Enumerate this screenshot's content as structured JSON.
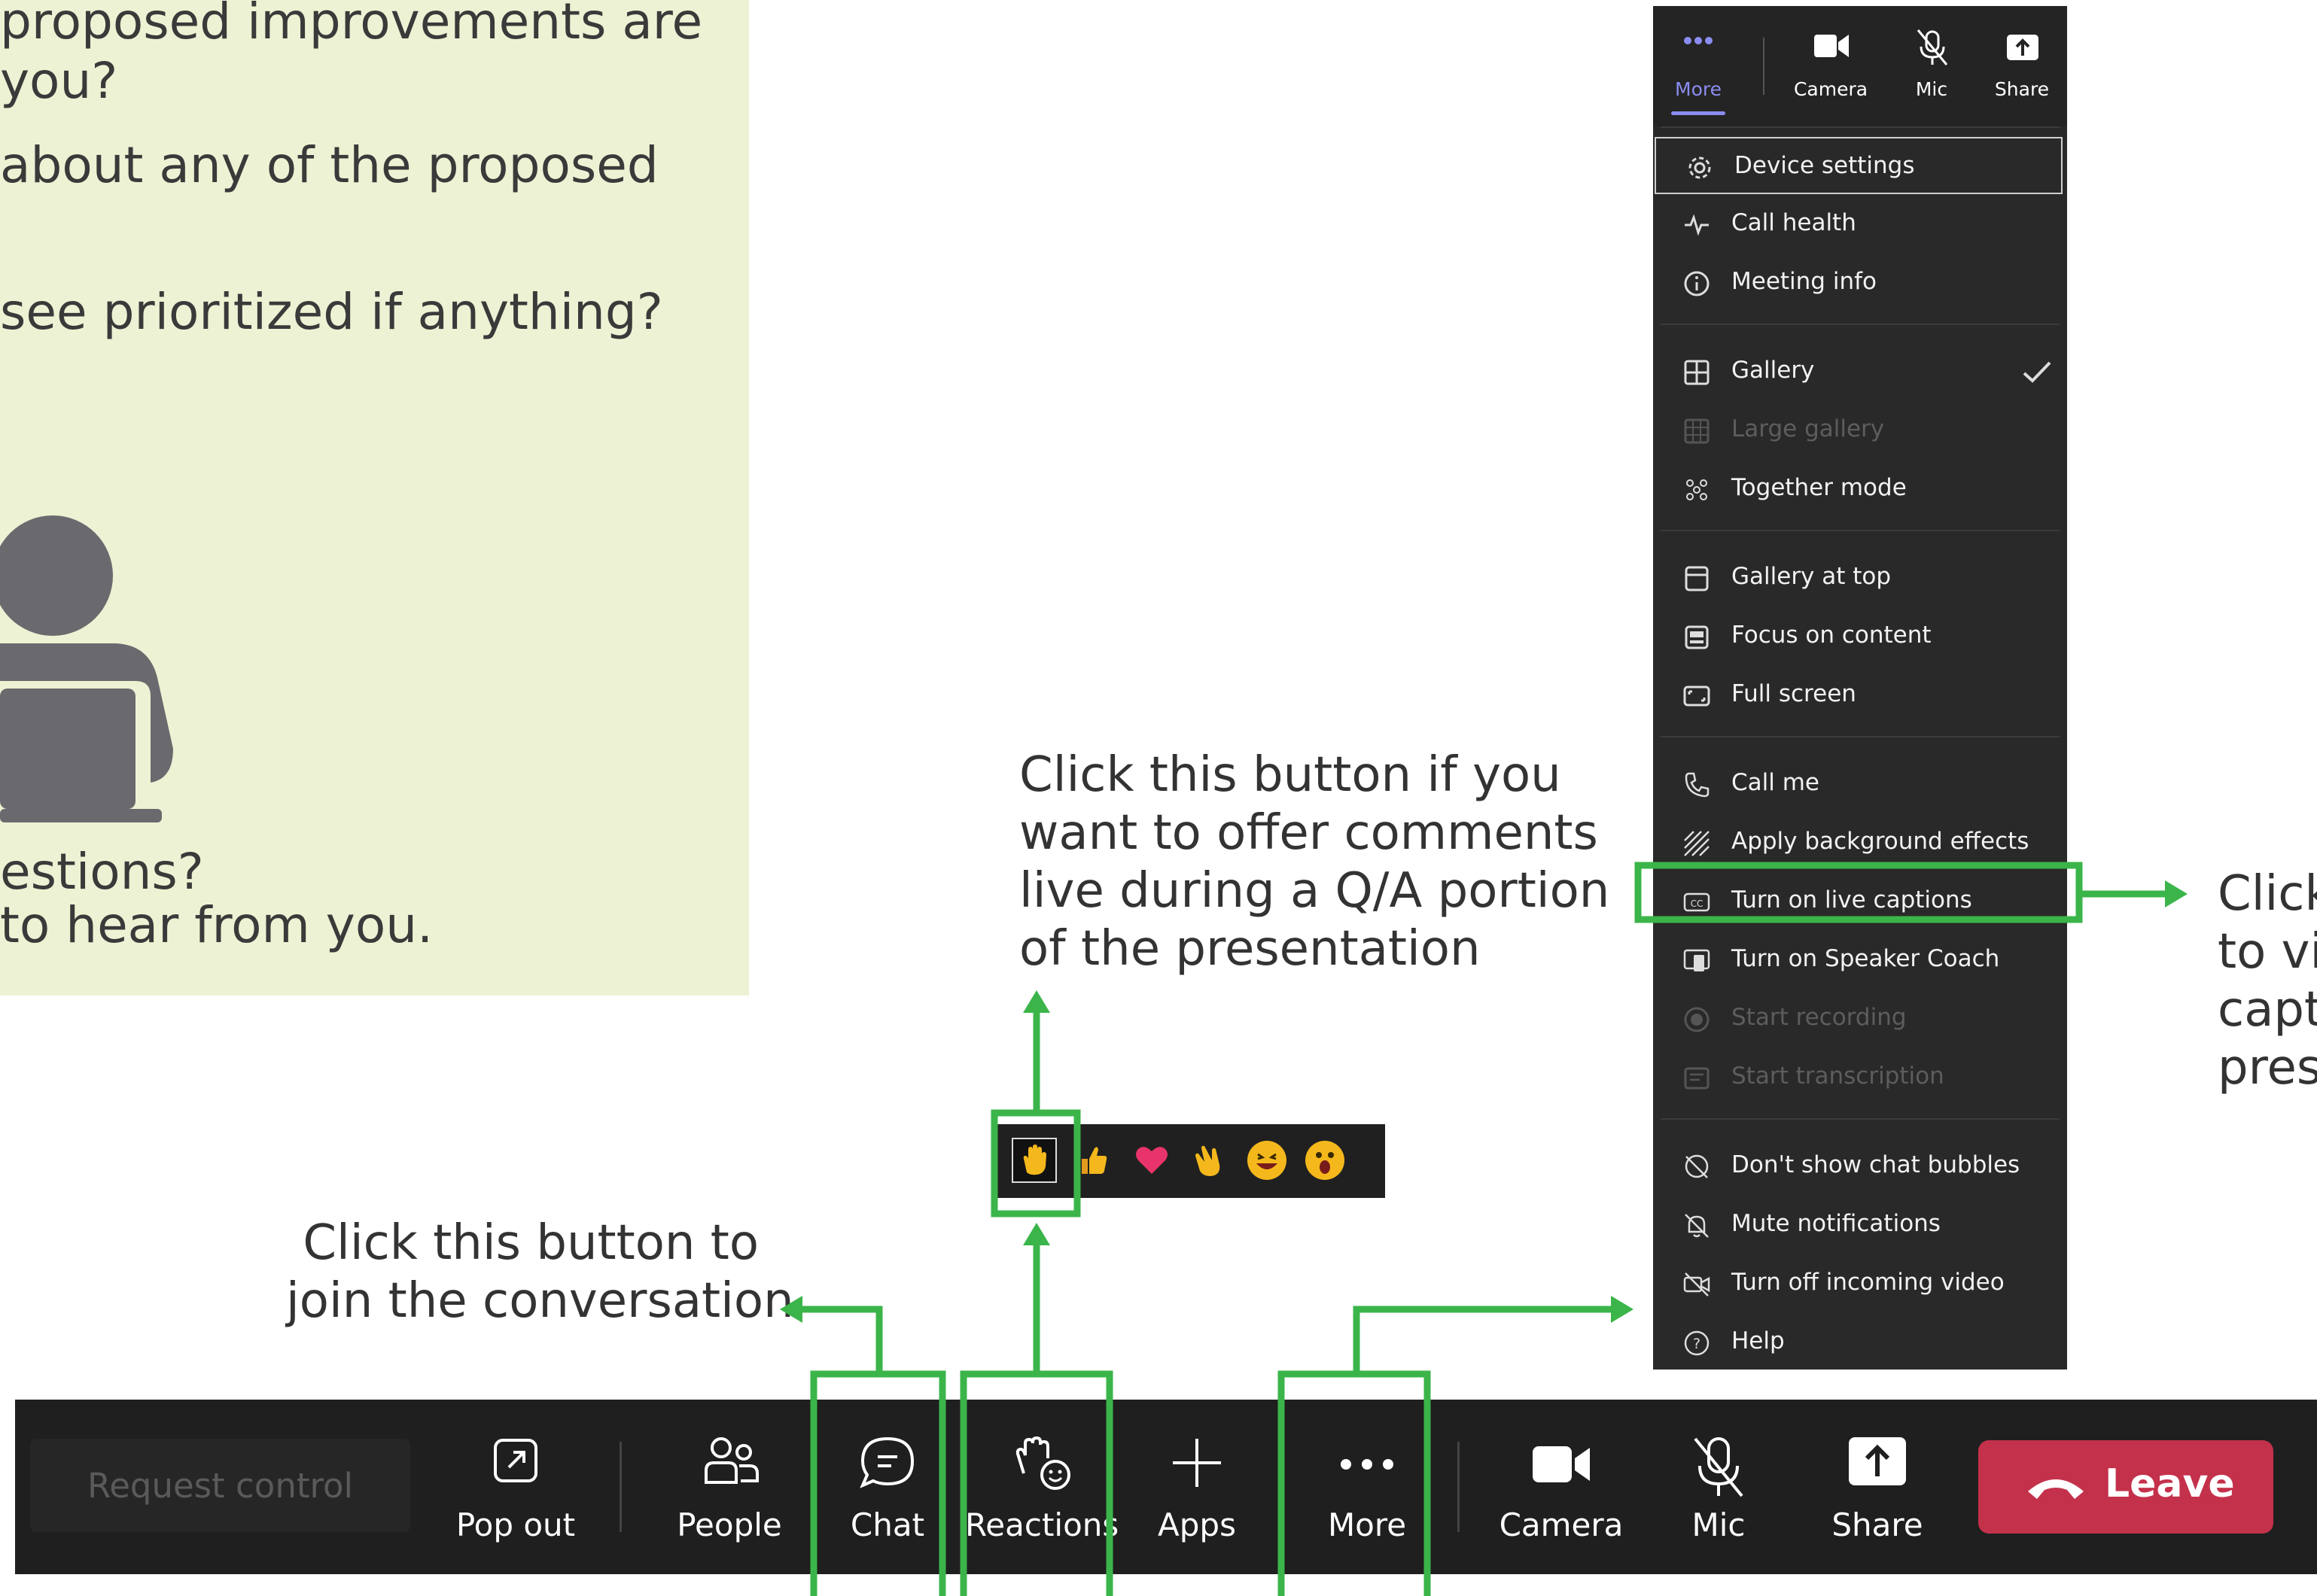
{
  "slide": {
    "line1": "proposed improvements are",
    "line2": "you?",
    "line3": "about any of the proposed",
    "line4": "see prioritized if anything?",
    "line5": "estions?",
    "line6": "to hear from you."
  },
  "callouts": {
    "reactions": [
      "Click this button if you",
      "want to offer comments",
      "live during a Q/A portion",
      "of the presentation"
    ],
    "chat": [
      "Click this button to",
      "join the conversation"
    ],
    "captions": [
      "Click",
      "to vi",
      "capt",
      "pres"
    ]
  },
  "menu": {
    "top": [
      {
        "label": "More",
        "icon": "more-icon"
      },
      {
        "label": "Camera",
        "icon": "camera-icon"
      },
      {
        "label": "Mic",
        "icon": "mic-off-icon"
      },
      {
        "label": "Share",
        "icon": "share-icon"
      }
    ],
    "items": [
      {
        "label": "Device settings",
        "icon": "gear-icon"
      },
      {
        "label": "Call health",
        "icon": "pulse-icon"
      },
      {
        "label": "Meeting info",
        "icon": "info-icon"
      },
      {
        "label": "Gallery",
        "icon": "gallery-icon",
        "checked": true
      },
      {
        "label": "Large gallery",
        "icon": "large-gallery-icon"
      },
      {
        "label": "Together mode",
        "icon": "together-mode-icon"
      },
      {
        "label": "Gallery at top",
        "icon": "gallery-top-icon"
      },
      {
        "label": "Focus on content",
        "icon": "focus-icon"
      },
      {
        "label": "Full screen",
        "icon": "fullscreen-icon"
      },
      {
        "label": "Call me",
        "icon": "phone-icon"
      },
      {
        "label": "Apply background effects",
        "icon": "background-effects-icon"
      },
      {
        "label": "Turn on live captions",
        "icon": "cc-icon"
      },
      {
        "label": "Turn on Speaker Coach",
        "icon": "speaker-coach-icon"
      },
      {
        "label": "Start recording",
        "icon": "record-icon"
      },
      {
        "label": "Start transcription",
        "icon": "transcription-icon"
      },
      {
        "label": "Don't show chat bubbles",
        "icon": "chat-bubble-off-icon"
      },
      {
        "label": "Mute notifications",
        "icon": "bell-off-icon"
      },
      {
        "label": "Turn off incoming video",
        "icon": "video-off-icon"
      },
      {
        "label": "Help",
        "icon": "help-icon"
      }
    ]
  },
  "reactions": [
    "raised-hand",
    "thumbs-up",
    "heart",
    "clap",
    "laugh",
    "surprised"
  ],
  "toolbar": {
    "request_control": "Request control",
    "pop_out": "Pop out",
    "people": "People",
    "chat": "Chat",
    "reactions": "Reactions",
    "apps": "Apps",
    "more": "More",
    "camera": "Camera",
    "mic": "Mic",
    "share": "Share",
    "leave": "Leave"
  },
  "colors": {
    "slide_bg": "#eef2d4",
    "highlight_green": "#3bb54a",
    "leave_red": "#c4314b",
    "teams_accent": "#8b8cf0",
    "menu_bg": "#292929",
    "toolbar_bg": "#1f1f1f"
  }
}
